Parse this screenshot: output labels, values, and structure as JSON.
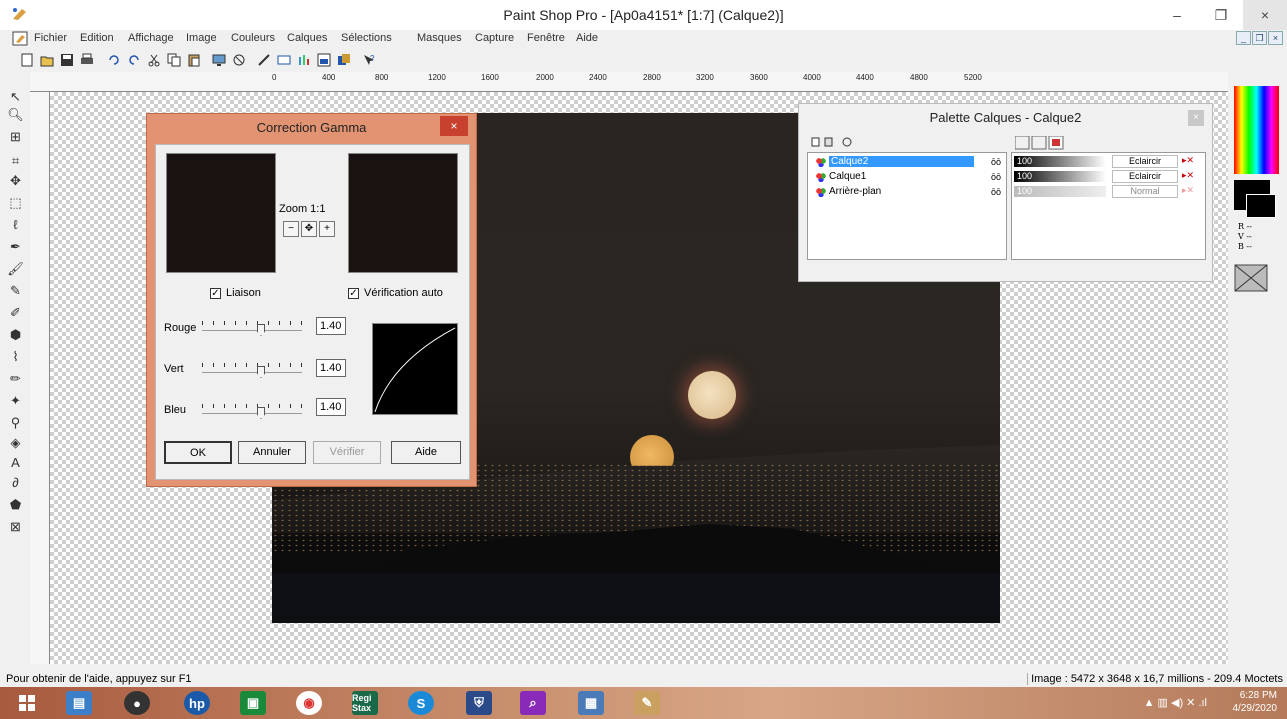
{
  "window": {
    "title": "Paint Shop Pro - [Ap0a4151* [1:7] (Calque2)]",
    "minimize": "–",
    "maximize": "❐",
    "close": "×"
  },
  "menu": [
    "Fichier",
    "Edition",
    "Affichage",
    "Image",
    "Couleurs",
    "Calques",
    "Sélections",
    "Masques",
    "Capture",
    "Fenêtre",
    "Aide"
  ],
  "ruler_marks": [
    "0",
    "400",
    "800",
    "1200",
    "1600",
    "2000",
    "2400",
    "2800",
    "3200",
    "3600",
    "4000",
    "4400",
    "4800",
    "5200"
  ],
  "gamma_dialog": {
    "title": "Correction Gamma",
    "close": "×",
    "zoom_label": "Zoom 1:1",
    "link_label": "Liaison",
    "link_checked": true,
    "autocheck_label": "Vérification auto",
    "autocheck_checked": true,
    "channels": [
      {
        "label": "Rouge",
        "value": "1.40",
        "level": 0.55
      },
      {
        "label": "Vert",
        "value": "1.40",
        "level": 0.55
      },
      {
        "label": "Bleu",
        "value": "1.40",
        "level": 0.55
      }
    ],
    "buttons": {
      "ok": "OK",
      "cancel": "Annuler",
      "verify": "Vérifier",
      "help": "Aide"
    }
  },
  "layers_palette": {
    "title": "Palette Calques - Calque2",
    "close": "×",
    "layers": [
      {
        "name": "Calque2",
        "opacity": "100",
        "mode": "Eclaircir",
        "selected": true
      },
      {
        "name": "Calque1",
        "opacity": "100",
        "mode": "Eclaircir",
        "selected": false
      },
      {
        "name": "Arrière-plan",
        "opacity": "100",
        "mode": "Normal",
        "selected": false
      }
    ]
  },
  "color_panel": {
    "r": "R --",
    "v": "V --",
    "b": "B --"
  },
  "status": {
    "help": "Pour obtenir de l'aide, appuyez sur F1",
    "image_info": "Image :  5472 x 3648 x 16,7 millions - 209.4 Moctets"
  },
  "taskbar": {
    "time": "6:28 PM",
    "date": "4/29/2020",
    "regi_label": "Regi Stax"
  },
  "colors": {
    "dialog_frame": "#e29472",
    "dialog_close": "#c7412e",
    "selected_layer": "#3399ff"
  }
}
